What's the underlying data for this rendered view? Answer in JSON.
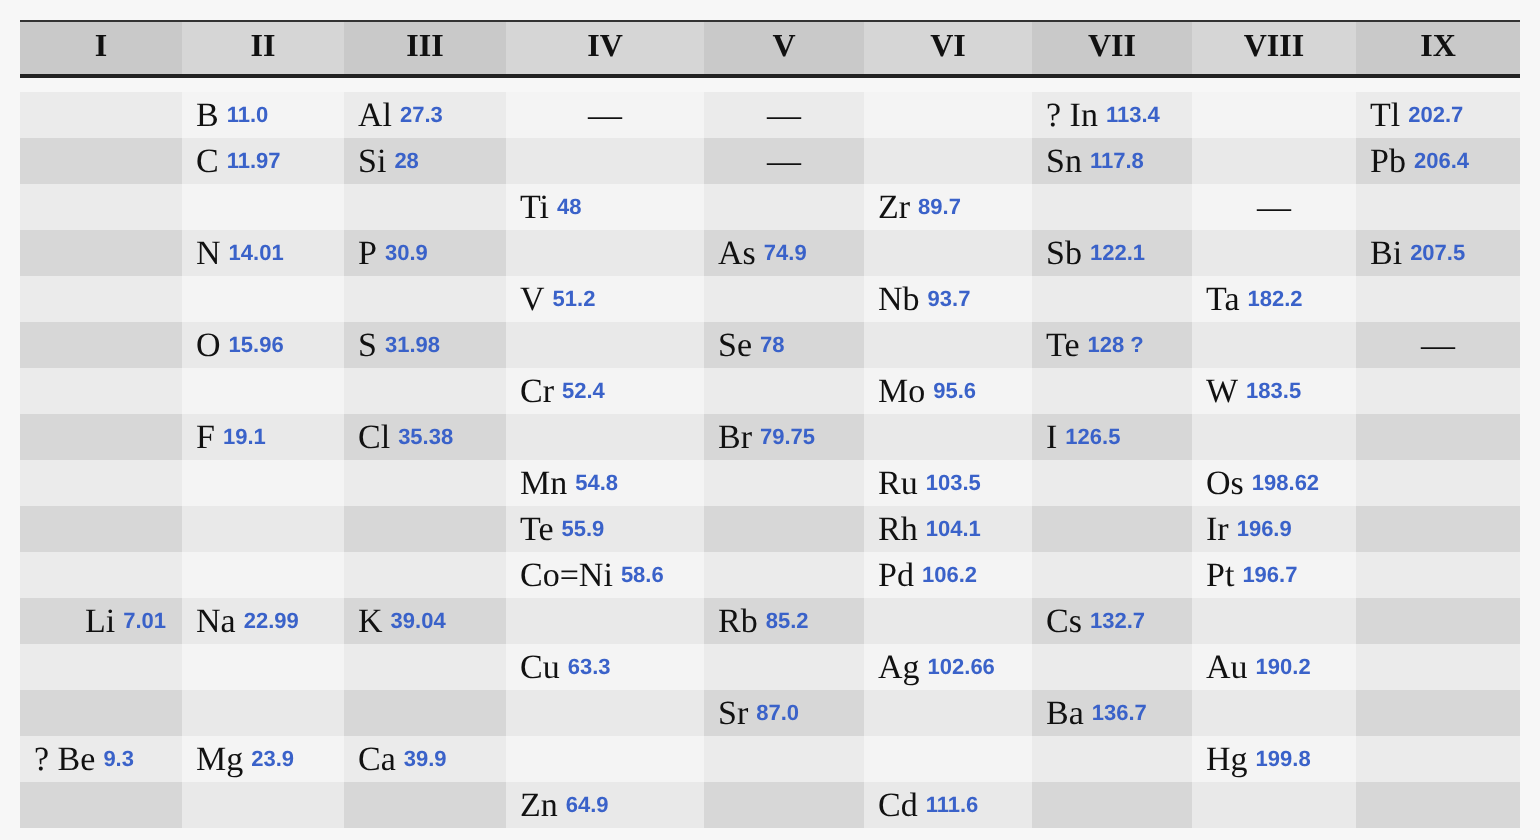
{
  "columns": [
    "I",
    "II",
    "III",
    "IV",
    "V",
    "VI",
    "VII",
    "VIII",
    "IX"
  ],
  "rows": [
    [
      null,
      {
        "symbol": "B",
        "weight": "11.0"
      },
      {
        "symbol": "Al",
        "weight": "27.3"
      },
      {
        "kind": "dash",
        "text": "—"
      },
      {
        "kind": "dash",
        "text": "—"
      },
      null,
      {
        "symbol": "? In",
        "weight": "113.4"
      },
      null,
      {
        "symbol": "Tl",
        "weight": "202.7"
      }
    ],
    [
      null,
      {
        "symbol": "C",
        "weight": "11.97"
      },
      {
        "symbol": "Si",
        "weight": "28"
      },
      null,
      {
        "kind": "dash",
        "text": "—"
      },
      null,
      {
        "symbol": "Sn",
        "weight": "117.8"
      },
      null,
      {
        "symbol": "Pb",
        "weight": "206.4"
      }
    ],
    [
      null,
      null,
      null,
      {
        "symbol": "Ti",
        "weight": "48"
      },
      null,
      {
        "symbol": "Zr",
        "weight": "89.7"
      },
      null,
      {
        "kind": "dash",
        "text": "—"
      },
      null
    ],
    [
      null,
      {
        "symbol": "N",
        "weight": "14.01"
      },
      {
        "symbol": "P",
        "weight": "30.9"
      },
      null,
      {
        "symbol": "As",
        "weight": "74.9"
      },
      null,
      {
        "symbol": "Sb",
        "weight": "122.1"
      },
      null,
      {
        "symbol": "Bi",
        "weight": "207.5"
      }
    ],
    [
      null,
      null,
      null,
      {
        "symbol": "V",
        "weight": "51.2"
      },
      null,
      {
        "symbol": "Nb",
        "weight": "93.7"
      },
      null,
      {
        "symbol": "Ta",
        "weight": "182.2"
      },
      null
    ],
    [
      null,
      {
        "symbol": "O",
        "weight": "15.96"
      },
      {
        "symbol": "S",
        "weight": "31.98"
      },
      null,
      {
        "symbol": "Se",
        "weight": "78"
      },
      null,
      {
        "symbol": "Te",
        "weight": "128 ?"
      },
      null,
      {
        "kind": "dash",
        "text": "—"
      }
    ],
    [
      null,
      null,
      null,
      {
        "symbol": "Cr",
        "weight": "52.4"
      },
      null,
      {
        "symbol": "Mo",
        "weight": "95.6"
      },
      null,
      {
        "symbol": "W",
        "weight": "183.5"
      },
      null
    ],
    [
      null,
      {
        "symbol": "F",
        "weight": "19.1"
      },
      {
        "symbol": "Cl",
        "weight": "35.38"
      },
      null,
      {
        "symbol": "Br",
        "weight": "79.75"
      },
      null,
      {
        "symbol": "I",
        "weight": "126.5"
      },
      null,
      null
    ],
    [
      null,
      null,
      null,
      {
        "symbol": "Mn",
        "weight": "54.8"
      },
      null,
      {
        "symbol": "Ru",
        "weight": "103.5"
      },
      null,
      {
        "symbol": "Os",
        "weight": "198.62"
      },
      null
    ],
    [
      null,
      null,
      null,
      {
        "symbol": "Te",
        "weight": "55.9"
      },
      null,
      {
        "symbol": "Rh",
        "weight": "104.1"
      },
      null,
      {
        "symbol": "Ir",
        "weight": "196.9"
      },
      null
    ],
    [
      null,
      null,
      null,
      {
        "symbol": "Co=Ni",
        "weight": "58.6"
      },
      null,
      {
        "symbol": "Pd",
        "weight": "106.2"
      },
      null,
      {
        "symbol": "Pt",
        "weight": "196.7"
      },
      null
    ],
    [
      {
        "symbol": "Li",
        "weight": "7.01"
      },
      {
        "symbol": "Na",
        "weight": "22.99"
      },
      {
        "symbol": "K",
        "weight": "39.04"
      },
      null,
      {
        "symbol": "Rb",
        "weight": "85.2"
      },
      null,
      {
        "symbol": "Cs",
        "weight": "132.7"
      },
      null,
      null
    ],
    [
      null,
      null,
      null,
      {
        "symbol": "Cu",
        "weight": "63.3"
      },
      null,
      {
        "symbol": "Ag",
        "weight": "102.66"
      },
      null,
      {
        "symbol": "Au",
        "weight": "190.2"
      },
      null
    ],
    [
      null,
      null,
      null,
      null,
      {
        "symbol": "Sr",
        "weight": "87.0"
      },
      null,
      {
        "symbol": "Ba",
        "weight": "136.7"
      },
      null,
      null
    ],
    [
      {
        "symbol": "? Be",
        "weight": "9.3"
      },
      {
        "symbol": "Mg",
        "weight": "23.9"
      },
      {
        "symbol": "Ca",
        "weight": "39.9"
      },
      null,
      null,
      null,
      null,
      {
        "symbol": "Hg",
        "weight": "199.8"
      },
      null
    ],
    [
      null,
      null,
      null,
      {
        "symbol": "Zn",
        "weight": "64.9"
      },
      null,
      {
        "symbol": "Cd",
        "weight": "111.6"
      },
      null,
      null,
      null
    ]
  ]
}
